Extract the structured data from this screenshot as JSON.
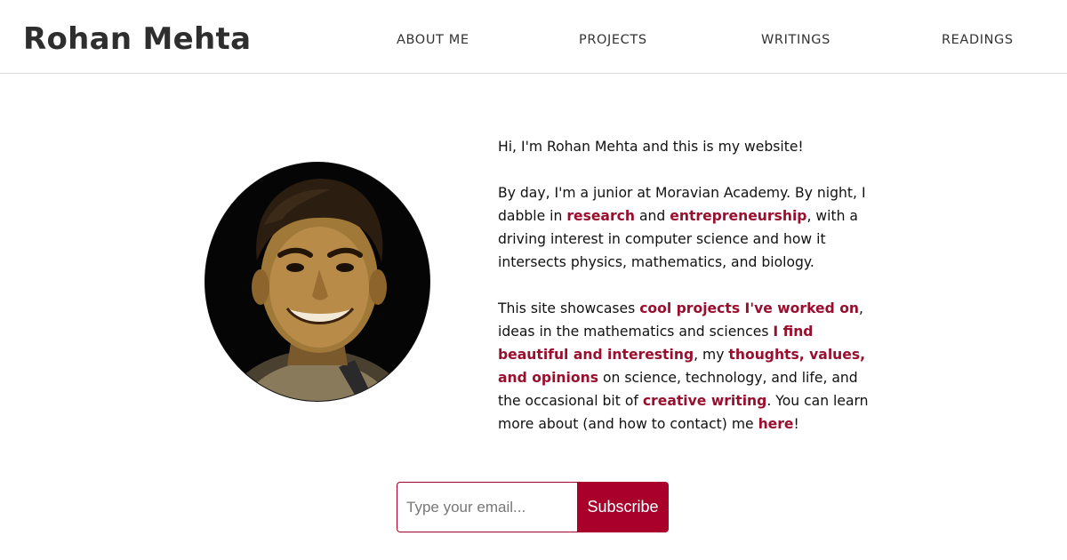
{
  "header": {
    "site_title": "Rohan Mehta",
    "nav": [
      "ABOUT ME",
      "PROJECTS",
      "WRITINGS",
      "READINGS"
    ]
  },
  "bio": {
    "p1": "Hi, I'm Rohan Mehta and this is my website!",
    "p2": {
      "t1": "By day, I'm a junior at Moravian Academy. By night, I dabble in ",
      "link_research": "research",
      "t2": " and ",
      "link_entrepreneurship": "entrepreneurship",
      "t3": ", with a driving interest in computer science and how it intersects physics, mathematics, and biology."
    },
    "p3": {
      "t1": "This site showcases ",
      "link_projects": "cool projects I've worked on",
      "t2": ", ideas in the mathematics and sciences ",
      "link_beautiful": "I find beautiful and interesting",
      "t3": ", my ",
      "link_thoughts": "thoughts, values, and opinions",
      "t4": " on science, technology, and life, and the occasional bit of ",
      "link_creative": "creative writing",
      "t5": ". You can learn more about (and how to contact) me ",
      "link_here": "here",
      "t6": "!"
    }
  },
  "subscribe": {
    "placeholder": "Type your email...",
    "button_label": "Subscribe"
  },
  "colors": {
    "accent": "#a8002b",
    "link": "#9a0f2e",
    "title": "#2e2e2e"
  }
}
